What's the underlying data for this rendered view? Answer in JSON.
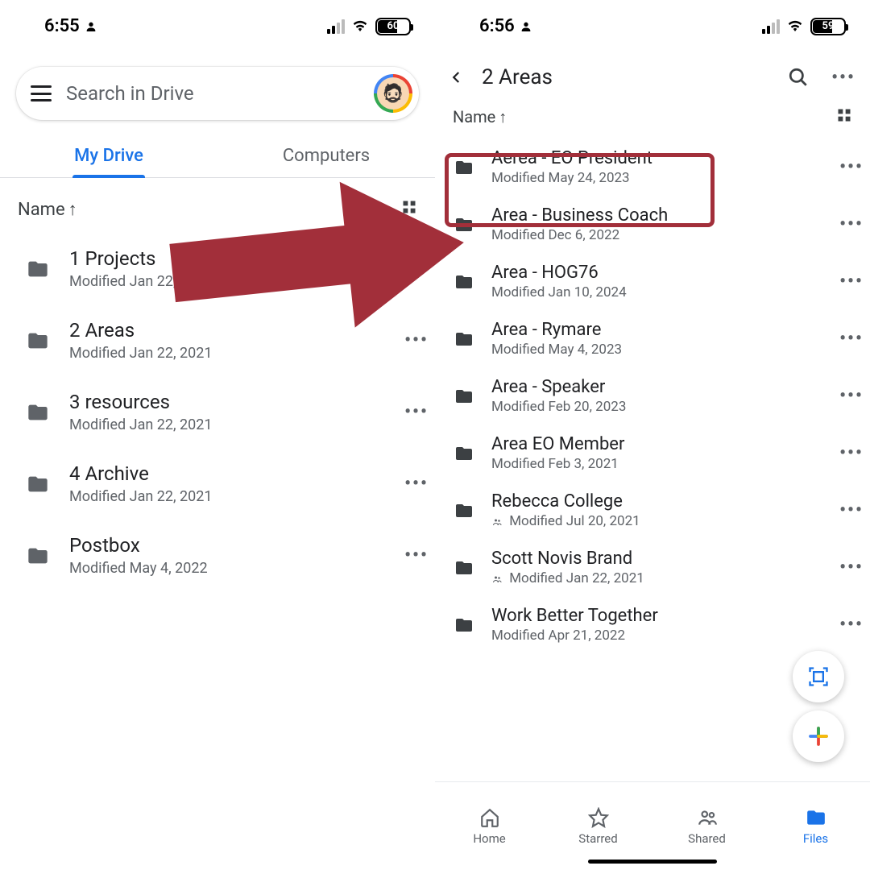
{
  "left": {
    "status": {
      "time": "6:55",
      "battery": "60"
    },
    "search_placeholder": "Search in Drive",
    "tabs": {
      "mydrive": "My Drive",
      "computers": "Computers"
    },
    "sort_label": "Name",
    "items": [
      {
        "title": "1 Projects",
        "sub": "Modified Jan 22, 2021"
      },
      {
        "title": "2 Areas",
        "sub": "Modified Jan 22, 2021"
      },
      {
        "title": "3 resources",
        "sub": "Modified Jan 22, 2021"
      },
      {
        "title": "4 Archive",
        "sub": "Modified Jan 22, 2021"
      },
      {
        "title": "Postbox",
        "sub": "Modified May 4, 2022"
      }
    ]
  },
  "right": {
    "status": {
      "time": "6:56",
      "battery": "59"
    },
    "nav_title": "2 Areas",
    "sort_label": "Name",
    "items": [
      {
        "title": "Aerea - EO President",
        "sub": "Modified May 24, 2023",
        "shared": false
      },
      {
        "title": "Area - Business Coach",
        "sub": "Modified Dec 6, 2022",
        "shared": false
      },
      {
        "title": "Area - HOG76",
        "sub": "Modified Jan 10, 2024",
        "shared": false
      },
      {
        "title": "Area - Rymare",
        "sub": "Modified May 4, 2023",
        "shared": false
      },
      {
        "title": "Area - Speaker",
        "sub": "Modified Feb 20, 2023",
        "shared": false
      },
      {
        "title": "Area EO Member",
        "sub": "Modified Feb 3, 2021",
        "shared": false
      },
      {
        "title": "Rebecca College",
        "sub": "Modified Jul 20, 2021",
        "shared": true
      },
      {
        "title": "Scott Novis Brand",
        "sub": "Modified Jan 22, 2021",
        "shared": true
      },
      {
        "title": "Work Better Together",
        "sub": "Modified Apr 21, 2022",
        "shared": false
      }
    ],
    "bottom_nav": {
      "home": "Home",
      "starred": "Starred",
      "shared": "Shared",
      "files": "Files"
    }
  }
}
